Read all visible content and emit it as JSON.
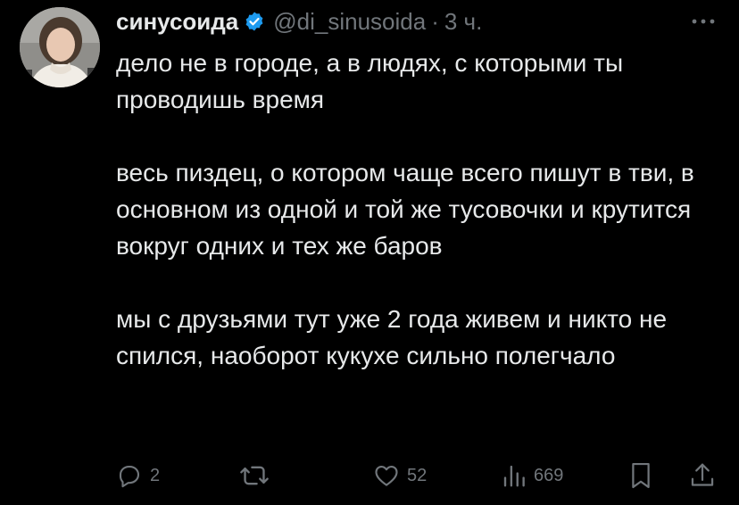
{
  "author": {
    "display_name": "синусоида",
    "handle": "@di_sinusoida",
    "separator": "·",
    "time": "3 ч."
  },
  "tweet": {
    "paragraphs": [
      "дело не в городе, а в людях, с которыми ты проводишь время",
      "весь пиздец, о котором чаще всего пишут в тви, в основном из одной и той же тусовочки и крутится вокруг одних и тех же баров",
      "мы с друзьями тут уже 2 года живем и никто не спился, наоборот кукухе сильно полегчало"
    ]
  },
  "actions": {
    "reply_count": "2",
    "retweet_count": "",
    "like_count": "52",
    "view_count": "669"
  },
  "colors": {
    "background": "#000000",
    "text": "#e7e9ea",
    "muted": "#71767b",
    "verified": "#1d9bf0"
  },
  "icons": {
    "verified": "verified-badge-icon",
    "more": "more-dots-icon",
    "reply": "reply-bubble-icon",
    "retweet": "retweet-icon",
    "like": "heart-icon",
    "views": "views-bar-icon",
    "bookmark": "bookmark-icon",
    "share": "share-icon"
  }
}
